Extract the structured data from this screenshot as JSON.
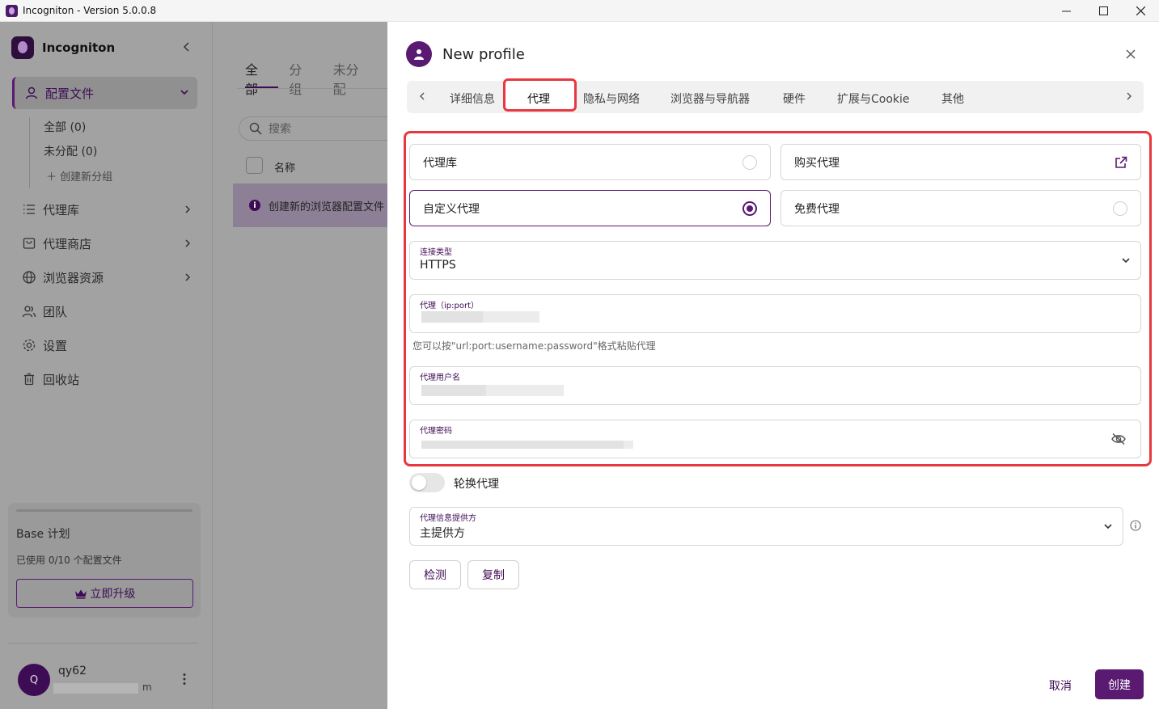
{
  "window": {
    "title": "Incogniton - Version 5.0.0.8"
  },
  "sidebar": {
    "app_name": "Incogniton",
    "profiles_label": "配置文件",
    "sub_items": [
      "全部 (0)",
      "未分配 (0)",
      "创建新分组"
    ],
    "nav": [
      {
        "label": "代理库",
        "icon": "list-icon"
      },
      {
        "label": "代理商店",
        "icon": "store-icon"
      },
      {
        "label": "浏览器资源",
        "icon": "globe-icon"
      },
      {
        "label": "团队",
        "icon": "team-icon"
      },
      {
        "label": "设置",
        "icon": "gear-icon"
      },
      {
        "label": "回收站",
        "icon": "trash-icon"
      }
    ],
    "plan": {
      "title": "Base 计划",
      "usage": "已使用 0/10 个配置文件",
      "upgrade_label": "立即升级"
    },
    "user": {
      "avatar_letter": "Q",
      "name": "qy62",
      "email_tail": "m"
    }
  },
  "middle": {
    "tabs": [
      "全部",
      "分组",
      "未分配"
    ],
    "search_placeholder": "搜索",
    "column_name": "名称",
    "banner": "创建新的浏览器配置文件"
  },
  "drawer": {
    "title": "New profile",
    "tabs": [
      "详细信息",
      "代理",
      "隐私与网络",
      "浏览器与导航器",
      "硬件",
      "扩展与Cookie",
      "其他"
    ],
    "active_tab": "代理",
    "options": {
      "proxy_library": "代理库",
      "buy_proxy": "购买代理",
      "custom_proxy": "自定义代理",
      "free_proxy": "免费代理"
    },
    "connection_type": {
      "label": "连接类型",
      "value": "HTTPS"
    },
    "proxy_address": {
      "label": "代理（ip:port）"
    },
    "paste_hint": "您可以按\"url:port:username:password\"格式粘贴代理",
    "proxy_username": {
      "label": "代理用户名"
    },
    "proxy_password": {
      "label": "代理密码"
    },
    "rotate_proxy": "轮换代理",
    "provider": {
      "label": "代理信息提供方",
      "value": "主提供方"
    },
    "check_button": "检测",
    "copy_button": "复制",
    "cancel_button": "取消",
    "create_button": "创建"
  },
  "colors": {
    "accent": "#5a1a72",
    "highlight": "#e8383f"
  }
}
